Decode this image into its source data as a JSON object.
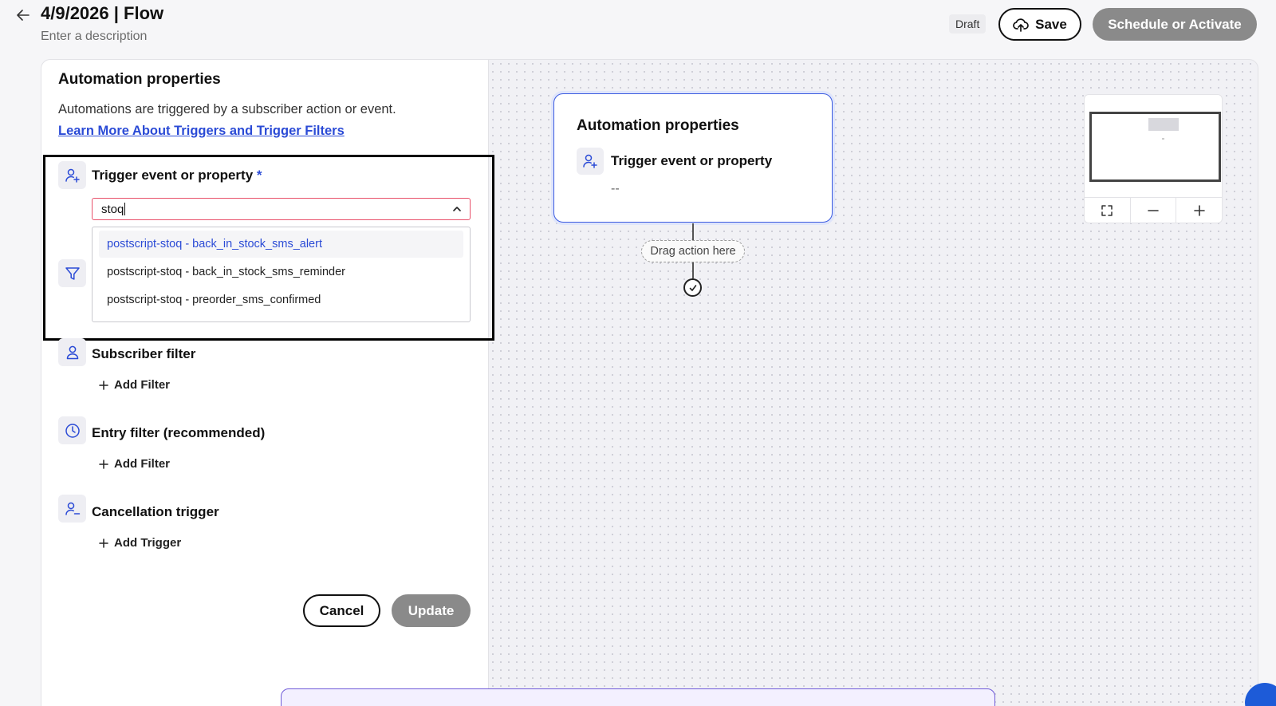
{
  "header": {
    "title": "4/9/2026 | Flow",
    "description_placeholder": "Enter a description",
    "status_badge": "Draft",
    "save_label": "Save",
    "schedule_label": "Schedule or Activate"
  },
  "panel": {
    "heading": "Automation properties",
    "info": "Automations are triggered by a subscriber action or event.",
    "link": "Learn More About Triggers and Trigger Filters",
    "trigger": {
      "label": "Trigger event or property",
      "required_mark": "*",
      "search_value": "stoq",
      "options": [
        "postscript-stoq - back_in_stock_sms_alert",
        "postscript-stoq - back_in_stock_sms_reminder",
        "postscript-stoq - preorder_sms_confirmed"
      ]
    },
    "subscriber_filter": {
      "label": "Subscriber filter",
      "add_label": "Add Filter"
    },
    "entry_filter": {
      "label": "Entry filter (recommended)",
      "add_label": "Add Filter"
    },
    "cancellation": {
      "label": "Cancellation trigger",
      "add_label": "Add Trigger"
    },
    "cancel_label": "Cancel",
    "update_label": "Update"
  },
  "canvas": {
    "node": {
      "title": "Automation properties",
      "trigger_label": "Trigger event or property",
      "trigger_value": "--"
    },
    "drop_zone": "Drag action here"
  },
  "colors": {
    "accent": "#2b4bd6",
    "disabled_button": "#8a8a8a",
    "error_border": "#e8506a"
  }
}
